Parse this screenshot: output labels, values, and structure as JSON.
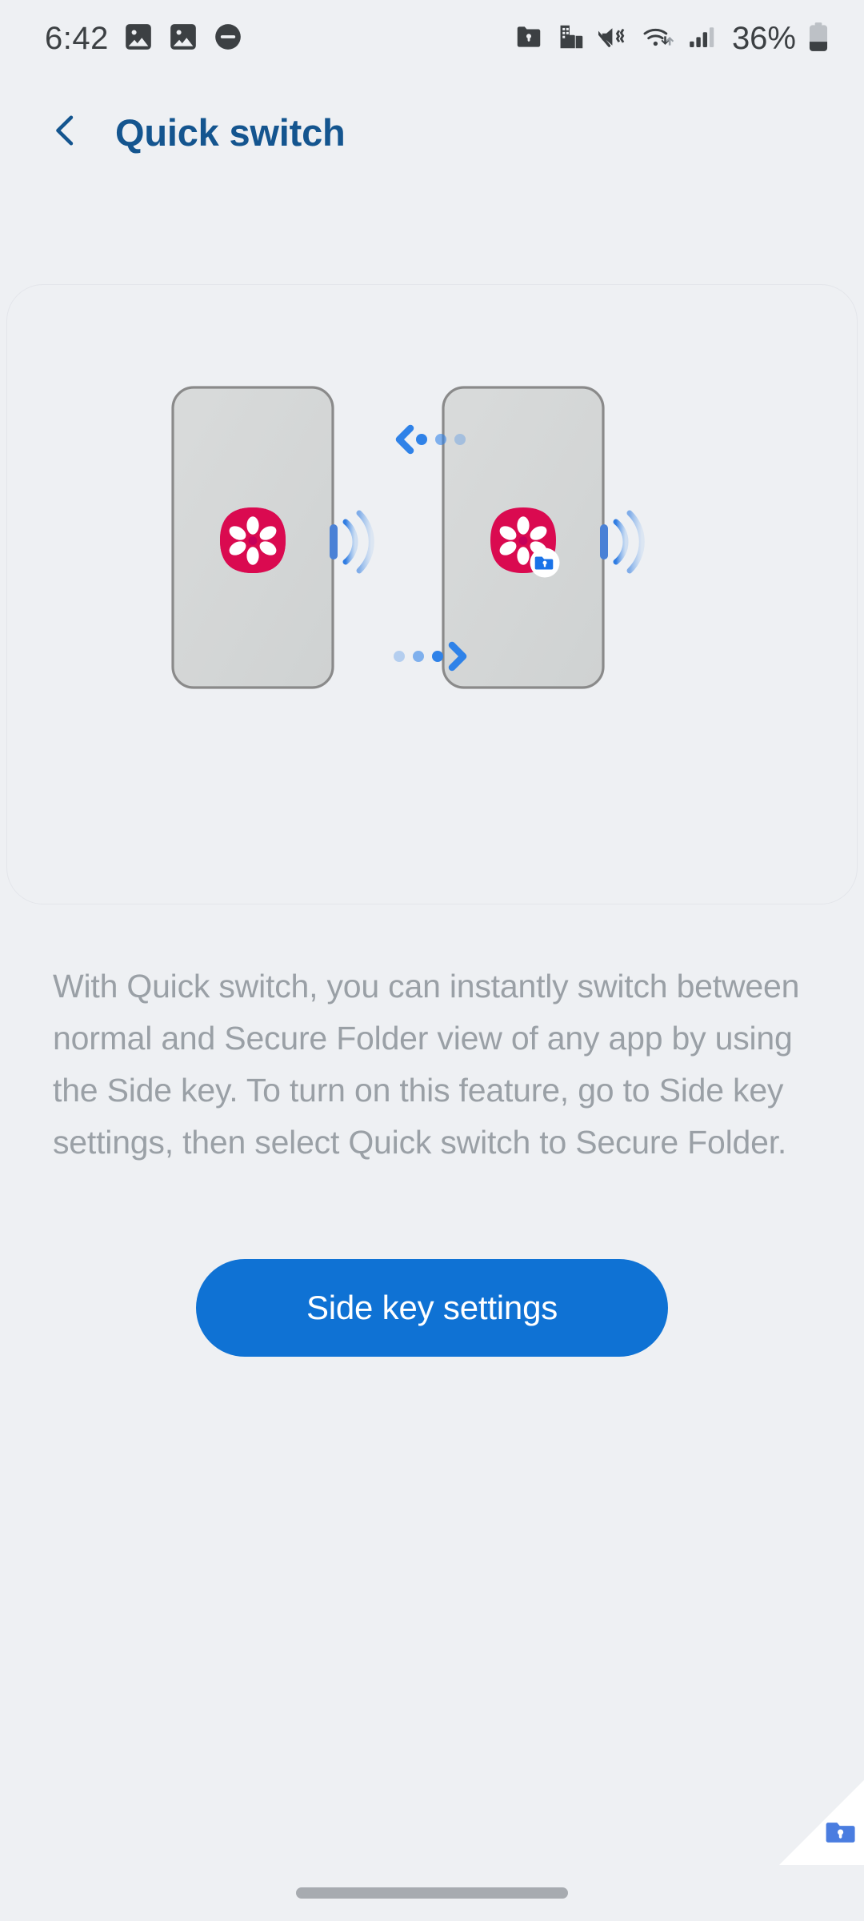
{
  "status_bar": {
    "time": "6:42",
    "battery_percent": "36%",
    "left_icons": [
      {
        "name": "gallery-image-icon-1",
        "label": "image"
      },
      {
        "name": "gallery-image-icon-2",
        "label": "image"
      },
      {
        "name": "do-not-disturb-icon",
        "label": "do not disturb"
      }
    ],
    "right_icons": [
      {
        "name": "secure-folder-icon",
        "label": "secure folder"
      },
      {
        "name": "work-profile-icon",
        "label": "work profile"
      },
      {
        "name": "sound-mute-vibrate-icon",
        "label": "mute vibrate"
      },
      {
        "name": "wifi-icon",
        "label": "wifi"
      },
      {
        "name": "cellular-signal-icon",
        "label": "signal"
      },
      {
        "name": "battery-icon",
        "label": "battery"
      }
    ]
  },
  "header": {
    "back_label": "Back",
    "title": "Quick switch"
  },
  "illustration": {
    "alt": "Two phones side by side; pressing the Side key switches between the normal app and its Secure Folder version",
    "left_phone_label": "Normal app view",
    "right_phone_label": "Secure Folder app view",
    "app_icon_name": "gallery-flower-app-icon",
    "badge_name": "secure-folder-badge-icon",
    "top_arrow_name": "switch-left-arrow",
    "bottom_arrow_name": "switch-right-arrow",
    "side_key_name": "side-key",
    "side_key_waves_name": "side-key-press-waves"
  },
  "description": {
    "text": "With Quick switch, you can instantly switch between normal and Secure Folder view of any app by using the Side key. To turn on this feature, go to Side key settings, then select Quick switch to Secure Folder."
  },
  "cta": {
    "label": "Side key settings"
  },
  "watermark": {
    "name": "secure-folder-corner-icon",
    "label": "Secure Folder"
  },
  "nav_bar": {
    "gesture_handle_label": "Home gesture handle"
  },
  "colors": {
    "background": "#eef0f3",
    "title": "#14558f",
    "accent_blue": "#0f72d4",
    "body_text": "#9aa0a6",
    "status_icon": "#3c4043",
    "phone_fill": "#d4d6d6",
    "phone_border": "#8a8a8a",
    "app_icon_pink": "#da0a50",
    "badge_blue": "#1a73e8"
  }
}
